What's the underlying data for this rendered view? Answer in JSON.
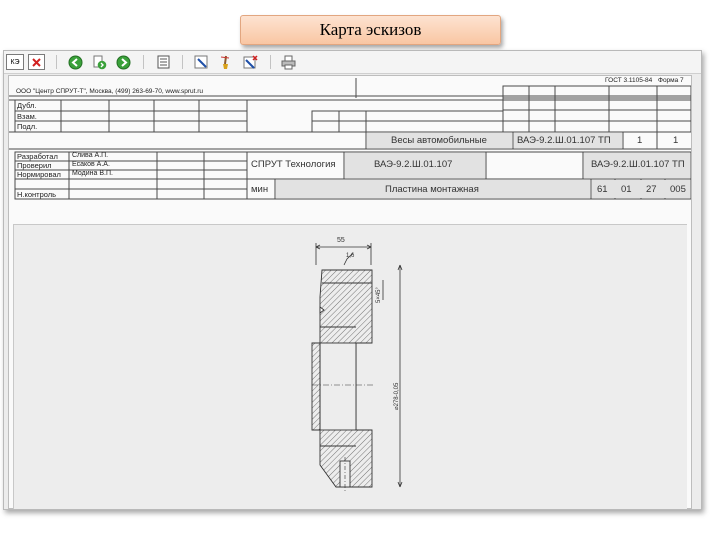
{
  "banner_title": "Карта эскизов",
  "toolbar": {
    "kz_label": "КЭ",
    "icons": [
      "close-icon",
      "back-icon",
      "page-forward-icon",
      "forward-icon",
      "list-icon",
      "edit-pencil-icon",
      "brush-icon",
      "delete-edit-icon",
      "print-icon"
    ]
  },
  "header": {
    "company": "ООО \"Центр СПРУТ-Т\", Москва, (499) 263-69-70, www.sprut.ru",
    "gost": "ГОСТ 3.1105-84",
    "form": "Форма 7",
    "rows_left": [
      "Дубл.",
      "Взам.",
      "Подл."
    ]
  },
  "document": {
    "product_name": "Весы автомобильные",
    "doc_code": "ВАЭ-9.2.Ш.01.107 ТП",
    "sheets_total": "1",
    "sheet_no": "1",
    "org": "СПРУТ Технология",
    "part_code": "ВАЭ-9.2.Ш.01.107",
    "doc_code_2": "ВАЭ-9.2.Ш.01.107 ТП",
    "unit_label": "мин",
    "part_name": "Пластина монтажная",
    "f1": "61",
    "f2": "01",
    "f3": "27",
    "f4": "005"
  },
  "signatures": [
    {
      "role": "Разработал",
      "name": "Слива А.П."
    },
    {
      "role": "Проверил",
      "name": "Есаков А.А."
    },
    {
      "role": "Нормировал",
      "name": "Модина В.П."
    },
    {
      "role": "",
      "name": ""
    },
    {
      "role": "Н.контроль",
      "name": ""
    }
  ],
  "sketch": {
    "dim_width": "55",
    "dim_roughness": "1,6",
    "dim_chamfer": "5×45°",
    "dim_diameter": "⌀278-0,05"
  }
}
